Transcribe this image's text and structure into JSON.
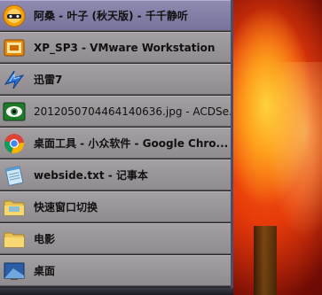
{
  "window_list": {
    "items": [
      {
        "label": "阿桑 - 叶子 (秋天版) - 千千静听",
        "icon": "ttplayer-icon"
      },
      {
        "label": "XP_SP3 - VMware Workstation",
        "icon": "vmware-icon"
      },
      {
        "label": "迅雷7",
        "icon": "thunder-icon"
      },
      {
        "label": "2012050704464140636.jpg - ACDSe...",
        "icon": "acdsee-icon"
      },
      {
        "label": "桌面工具 - 小众软件 - Google Chro...",
        "icon": "chrome-icon"
      },
      {
        "label": "webside.txt - 记事本",
        "icon": "notepad-icon"
      },
      {
        "label": "快速窗口切换",
        "icon": "folder-icon"
      },
      {
        "label": "电影",
        "icon": "folder-icon"
      },
      {
        "label": "桌面",
        "icon": "desktop-icon"
      }
    ]
  },
  "colors": {
    "selected_item": "#8e8ab0",
    "item": "#a39fa3",
    "panel_border": "#4a4e6a"
  }
}
